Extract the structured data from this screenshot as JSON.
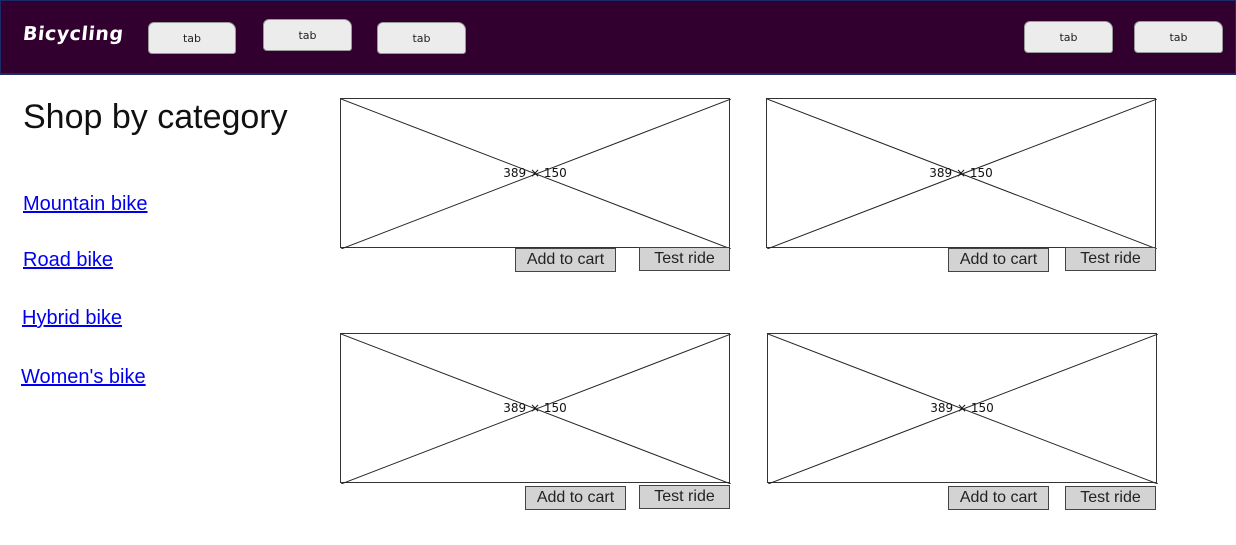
{
  "header": {
    "brand": "Bicycling",
    "tabs": [
      {
        "label": "tab"
      },
      {
        "label": "tab"
      },
      {
        "label": "tab"
      },
      {
        "label": "tab"
      },
      {
        "label": "tab"
      }
    ],
    "colors": {
      "background": "#32002f",
      "border": "#1c2a6b"
    }
  },
  "main": {
    "title": "Shop by category",
    "categories": [
      {
        "label": "Mountain bike"
      },
      {
        "label": "Road bike"
      },
      {
        "label": "Hybrid bike"
      },
      {
        "label": "Women's bike"
      }
    ],
    "products": [
      {
        "image_label": "389 × 150",
        "add_label": "Add to cart",
        "ride_label": "Test ride"
      },
      {
        "image_label": "389 × 150",
        "add_label": "Add to cart",
        "ride_label": "Test ride"
      },
      {
        "image_label": "389 × 150",
        "add_label": "Add to cart",
        "ride_label": "Test ride"
      },
      {
        "image_label": "389 × 150",
        "add_label": "Add to cart",
        "ride_label": "Test ride"
      }
    ]
  },
  "colors": {
    "link": "#0000ee",
    "button_bg": "#d3d3d3"
  }
}
